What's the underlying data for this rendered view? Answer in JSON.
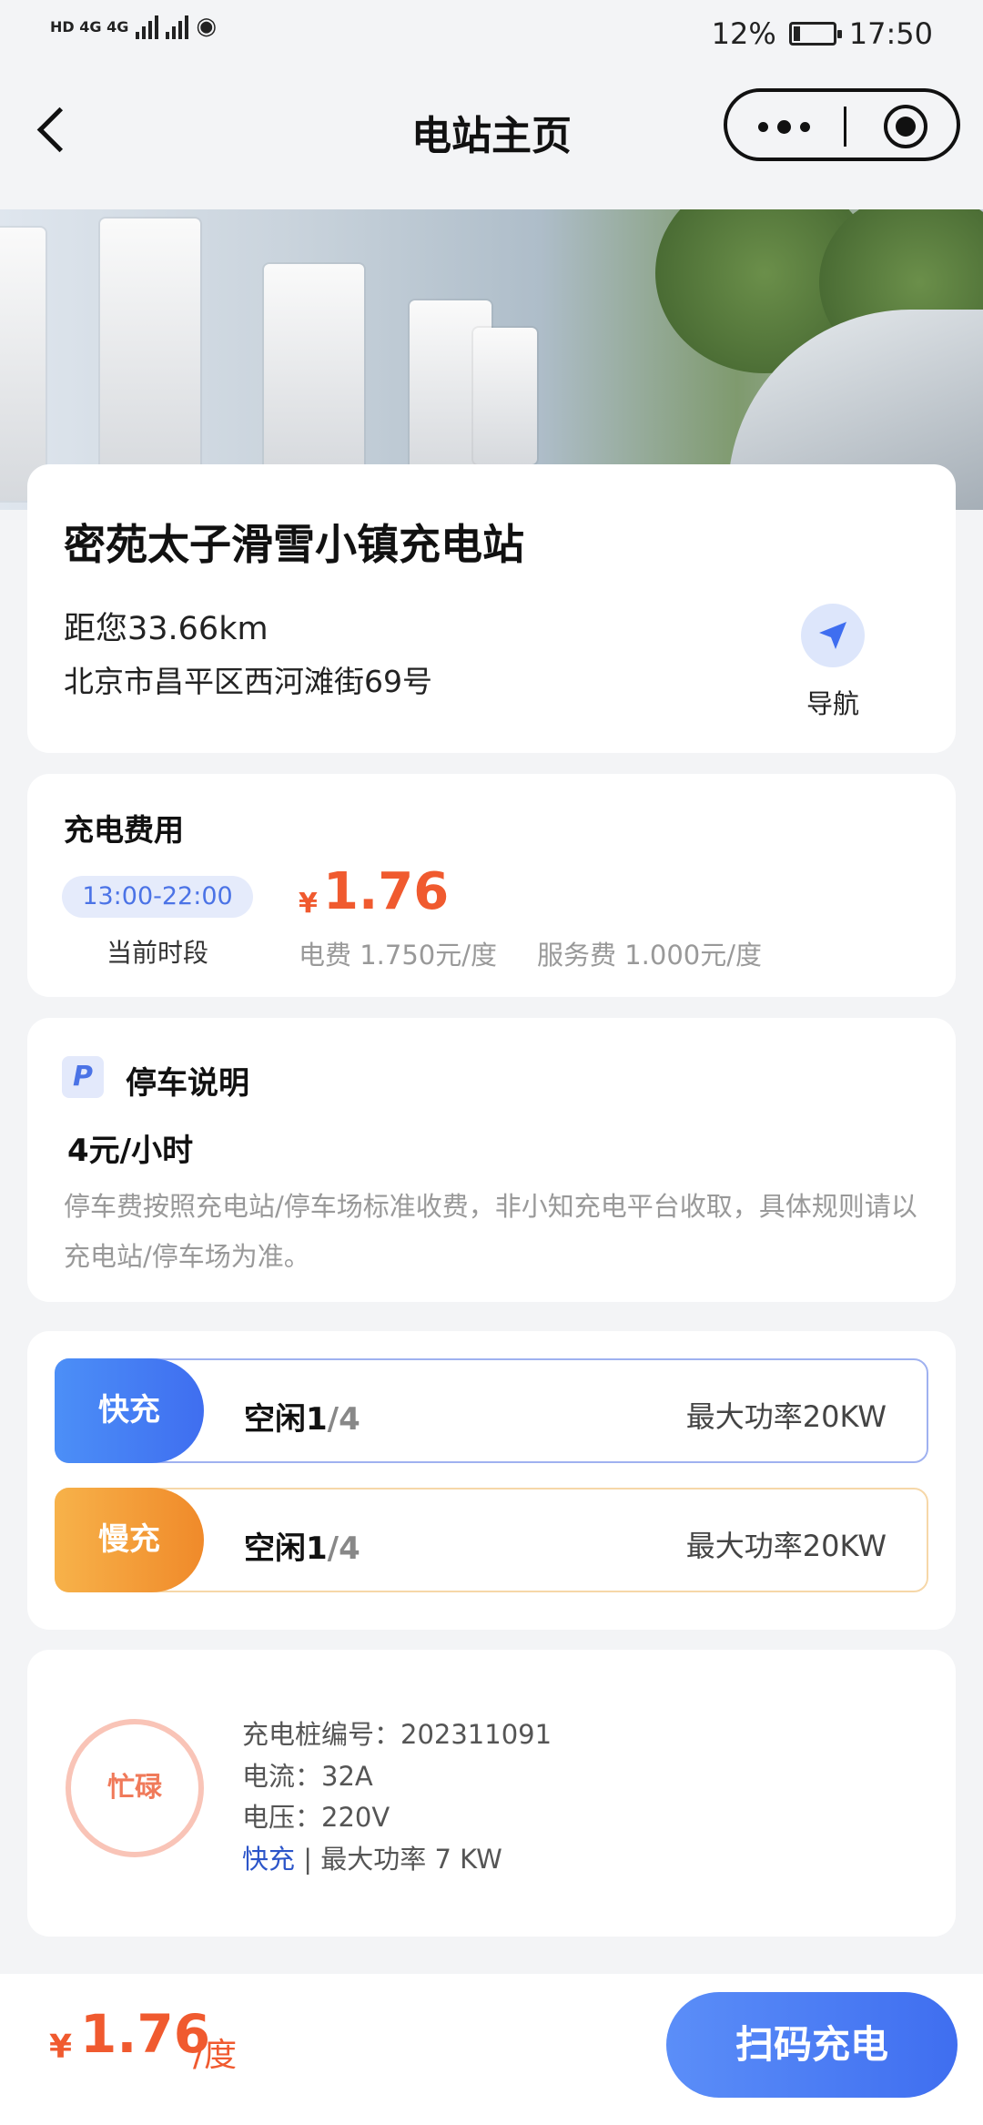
{
  "status_bar": {
    "left_text": "HD 4G 4G",
    "battery": "12%",
    "time": "17:50"
  },
  "nav": {
    "title": "电站主页"
  },
  "station": {
    "name": "密苑太子滑雪小镇充电站",
    "distance": "距您33.66km",
    "address": "北京市昌平区西河滩街69号",
    "nav_label": "导航"
  },
  "fee": {
    "title": "充电费用",
    "time_range": "13:00-22:00",
    "time_caption": "当前时段",
    "currency": "¥",
    "price": "1.76",
    "electricity": "电费 1.750元/度",
    "service": "服务费 1.000元/度"
  },
  "parking": {
    "icon_letter": "P",
    "title": "停车说明",
    "price": "4元/小时",
    "description": "停车费按照充电站/停车场标准收费，非小知充电平台收取，具体规则请以充电站/停车场为准。"
  },
  "piles": [
    {
      "tag": "快充",
      "idle_label": "空闲",
      "idle": "1",
      "total": "/4",
      "power": "最大功率20KW"
    },
    {
      "tag": "慢充",
      "idle_label": "空闲",
      "idle": "1",
      "total": "/4",
      "power": "最大功率20KW"
    }
  ],
  "pile_detail": {
    "status": "忙碌",
    "number": "充电桩编号：202311091",
    "current": "电流：32A",
    "voltage": "电压：220V",
    "type": "快充",
    "power": " | 最大功率 7 KW"
  },
  "bottom": {
    "currency": "¥",
    "price": "1.76",
    "unit": "/度",
    "scan_button": "扫码充电"
  }
}
